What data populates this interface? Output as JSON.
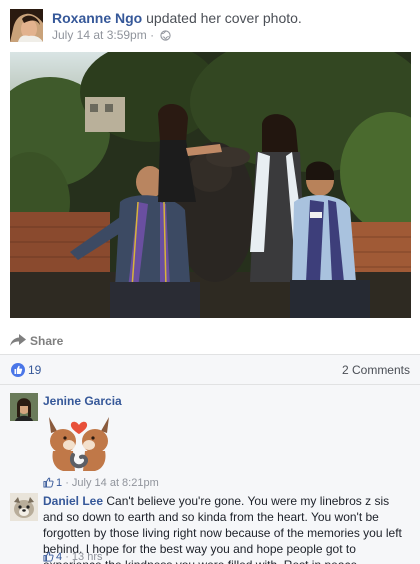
{
  "post": {
    "author": "Roxanne Ngo",
    "action": "updated her cover photo.",
    "time": "July 14 at 3:59pm",
    "separator": "·"
  },
  "share": {
    "label": "Share"
  },
  "stats": {
    "likes": "19",
    "comments": "2 Comments"
  },
  "comments": [
    {
      "author": "Jenine Garcia",
      "text": "",
      "has_sticker": true,
      "likes": "1",
      "time": "July 14 at 8:21pm"
    },
    {
      "author": "Daniel Lee",
      "text": "Can't believe you're gone. You were my linebros z sis and so down to earth and so kinda from the heart. You won't be forgotten by those living right now because of the memories you left behind. I hope for the best way you and hope people got to experience the kindness you were filled with. Rest in peace.",
      "likes": "4",
      "time": "13 hrs"
    }
  ],
  "icons": {
    "globe": "globe-icon",
    "share": "share-arrow-icon",
    "like": "thumbs-up-icon"
  },
  "colors": {
    "link_blue": "#365899",
    "like_blue": "#4a76e8",
    "meta_gray": "#90949c",
    "comment_bg": "#f6f7f9"
  }
}
